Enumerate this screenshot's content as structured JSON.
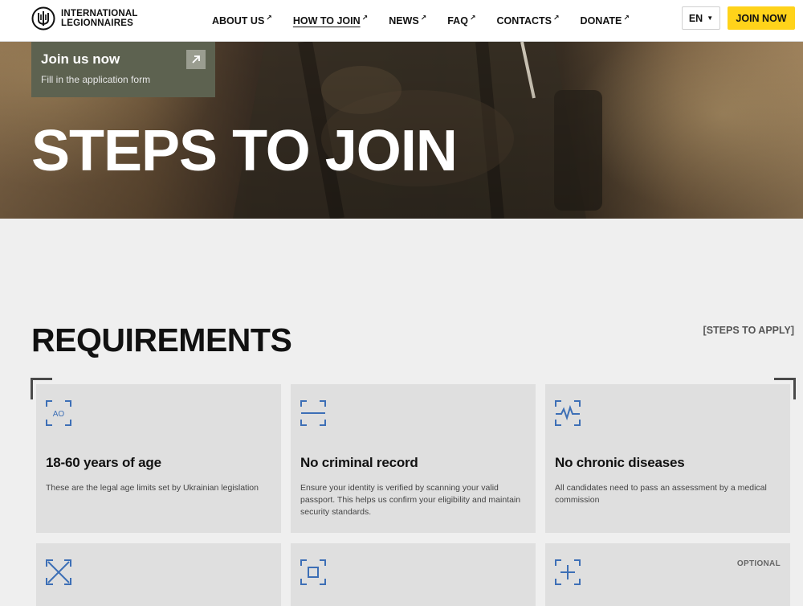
{
  "header": {
    "logo_line1": "INTERNATIONAL",
    "logo_line2": "LEGIONNAIRES",
    "nav": [
      {
        "label": "ABOUT US",
        "arrow": "↗"
      },
      {
        "label": "HOW TO JOIN",
        "arrow": "↗"
      },
      {
        "label": "NEWS",
        "arrow": "↗"
      },
      {
        "label": "FAQ",
        "arrow": "↗"
      },
      {
        "label": "CONTACTS",
        "arrow": "↗"
      },
      {
        "label": "DONATE",
        "arrow": "↗"
      }
    ],
    "active_nav": "HOW TO JOIN",
    "language": "EN",
    "join_button": "JOIN NOW",
    "accent_color": "#ffd31a"
  },
  "hero": {
    "card_title": "Join us now",
    "card_subtitle": "Fill in the application form",
    "title": "STEPS TO JOIN"
  },
  "requirements": {
    "title": "REQUIREMENTS",
    "steps_link": "[STEPS TO APPLY]",
    "icon_color": "#3d6fb6",
    "cards": [
      {
        "icon": "age-icon",
        "icon_text": "AO",
        "title": "18-60 years of age",
        "desc": "These are the legal age limits set by Ukrainian legislation"
      },
      {
        "icon": "scan-icon",
        "title": "No criminal record",
        "desc": "Ensure your identity is verified by scanning your valid passport. This helps us confirm your eligibility and maintain security standards."
      },
      {
        "icon": "heartbeat-icon",
        "title": "No chronic diseases",
        "desc": "All candidates need to pass an assessment by a medical commission"
      },
      {
        "icon": "expand-icon",
        "title": "",
        "desc": ""
      },
      {
        "icon": "focus-icon",
        "title": "",
        "desc": ""
      },
      {
        "icon": "plus-frame-icon",
        "title": "",
        "desc": "",
        "badge": "OPTIONAL"
      }
    ]
  }
}
